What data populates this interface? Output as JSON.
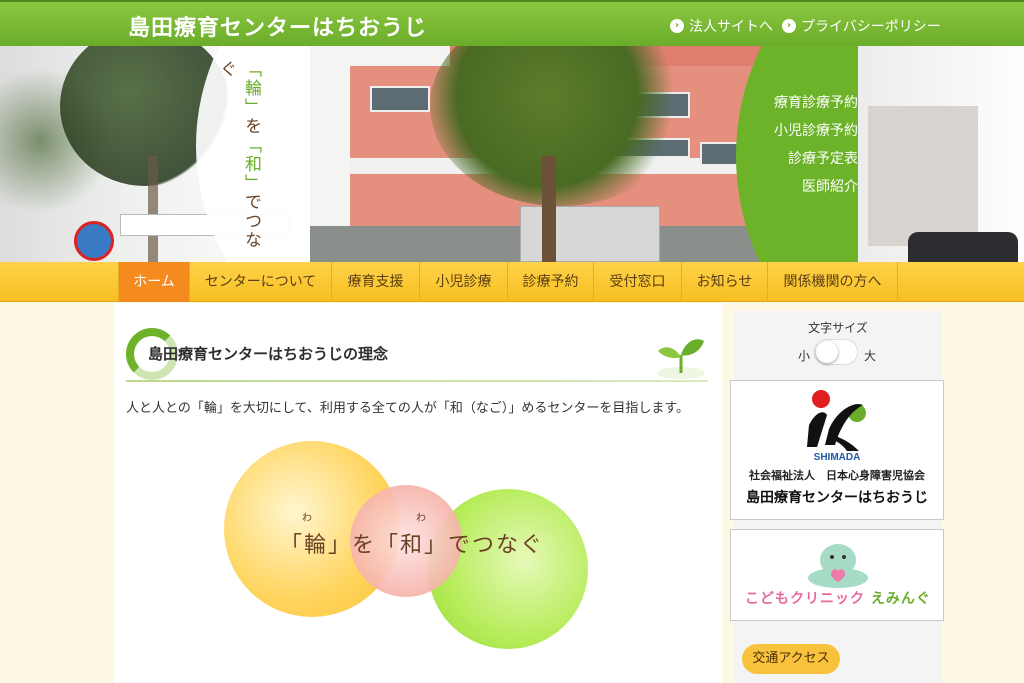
{
  "header": {
    "site_title": "島田療育センターはちおうじ",
    "links": [
      "法人サイトへ",
      "プライバシーポリシー"
    ]
  },
  "hero": {
    "motto_parts": [
      "「輪」",
      "を",
      "「和」",
      "でつなぐ"
    ],
    "links": [
      "療育診療予約",
      "小児診療予約",
      "診療予定表",
      "医師紹介"
    ]
  },
  "nav": {
    "items": [
      "ホーム",
      "センターについて",
      "療育支援",
      "小児診療",
      "診療予約",
      "受付窓口",
      "お知らせ",
      "関係機関の方へ"
    ],
    "active_index": 0
  },
  "main": {
    "heading": "島田療育センターはちおうじの理念",
    "intro": "人と人との「輪」を大切にして、利用する全ての人が「和（なご）」めるセンターを目指します。",
    "motto": "「輪」を「和」でつなぐ",
    "ruby": [
      "わ",
      "わ"
    ]
  },
  "sidebar": {
    "font_size_label": "文字サイズ",
    "font_small": "小",
    "font_large": "大",
    "banner1": {
      "logo_word": "SHIMADA",
      "org": "社会福祉法人　日本心身障害児協会",
      "name": "島田療育センターはちおうじ"
    },
    "banner2": {
      "name_part1": "こどもクリニック",
      "name_part2": "えみんぐ"
    },
    "access_button": "交通アクセス"
  },
  "colors": {
    "green": "#6db32a",
    "nav_yellow": "#f7c022",
    "nav_active": "#f58a1f"
  }
}
